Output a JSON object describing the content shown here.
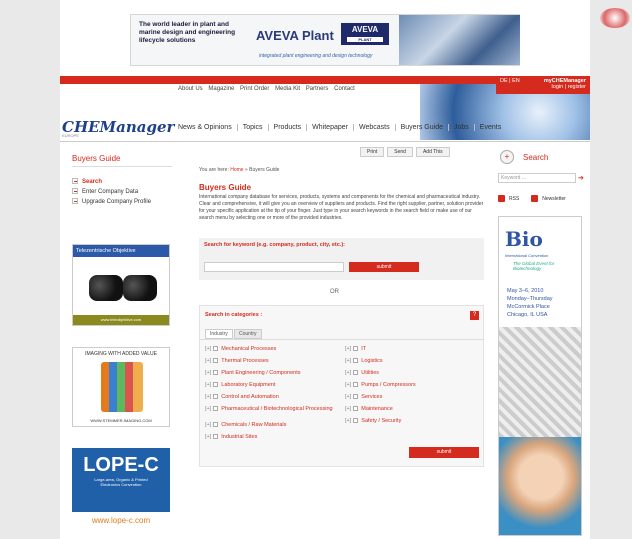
{
  "banner": {
    "headline": "The world leader in plant and marine design and engineering lifecycle solutions",
    "product": "AVEVA Plant",
    "logo": "AVEVA",
    "logo_sub": "PLANT",
    "tagline": "integrated plant engineering and design technology"
  },
  "topnav": [
    "About Us",
    "Magazine",
    "Print Order",
    "Media Kit",
    "Partners",
    "Contact"
  ],
  "lang": {
    "languages": "DE | EN",
    "account_title": "myCHEManager",
    "account_links": "login | register"
  },
  "brand": {
    "logo": "CHEManager",
    "sub": "EUROPE"
  },
  "mainnav": [
    "News & Opinions",
    "Topics",
    "Products",
    "Whitepaper",
    "Webcasts",
    "Buyers Guide",
    "Jobs",
    "Events"
  ],
  "sidebar": {
    "title": "Buyers Guide",
    "links": [
      "Search",
      "Enter Company Data",
      "Upgrade Company Profile"
    ]
  },
  "ads": {
    "ad1_header": "Telezentrische Objektive",
    "ad1_footer": "www.teleobjektive.com",
    "ad2_header": "IMAGING WITH ADDED VALUE",
    "ad2_footer": "WWW.STEMMER-IMAGING.COM",
    "ad3_title": "LOPE-C",
    "ad3_sub": "Large-area, Organic & Printed Electronics Convention",
    "ad3_url": "www.lope-c.com"
  },
  "tools": [
    "Print",
    "Send",
    "Add This"
  ],
  "main": {
    "breadcrumb_prefix": "You are here: ",
    "breadcrumb_home": "Home",
    "breadcrumb_rest": " » Buyers Guide",
    "title": "Buyers Guide",
    "intro": "International company database for services, products, systems and components for the chemical and pharmaceutical industry. Clear and comprehensive, it will give you an overview of suppliers and products. Find the right supplier, partner, solution provider for your specific application at the tip of your finger. Just type in your search keywords in the search field or make use of our search menu by selecting one or more of the provided industries.",
    "search_label": "Search for keyword (e.g. company, product, city, etc.):",
    "search_button": "submit",
    "or": "OR",
    "categories_label": "Search in categories :",
    "help": "?",
    "tabs": [
      "Industry",
      "Country"
    ],
    "categories_left": [
      "Mechanical Processes",
      "Thermal Processes",
      "Plant Engineering / Components",
      "Laboratory Equipment",
      "Control and Automation",
      "Pharmaceutical / Biotechnological Processing",
      "Chemicals / Raw Materials",
      "Industrial Sites"
    ],
    "categories_right": [
      "IT",
      "Logistics",
      "Utilities",
      "Pumps / Compressors",
      "Services",
      "Maintenance",
      "Safety / Security"
    ],
    "submit_button": "submit"
  },
  "right": {
    "search_title": "Search",
    "keyword_placeholder": "Keyword ...",
    "rss": "RSS",
    "newsletter": "Newsletter",
    "bio_title": "Bio",
    "bio_sub": "International Convention",
    "bio_tag": "The Global Event for Biotechnology",
    "bio_dates": "May 3–6, 2010",
    "bio_days": "Monday–Thursday",
    "bio_place": "McCormick Place",
    "bio_city": "Chicago, IL USA"
  }
}
